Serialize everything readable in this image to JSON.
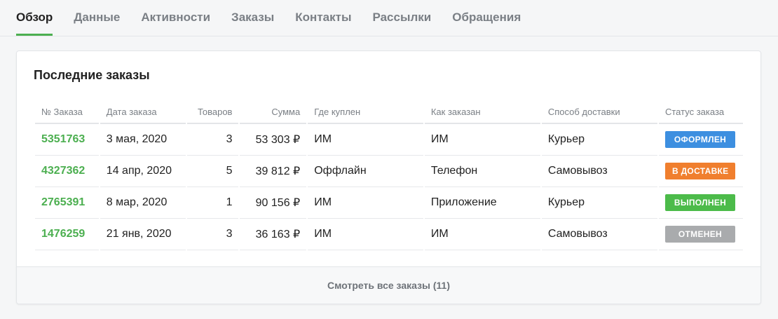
{
  "tabs": [
    {
      "label": "Обзор",
      "active": true
    },
    {
      "label": "Данные",
      "active": false
    },
    {
      "label": "Активности",
      "active": false
    },
    {
      "label": "Заказы",
      "active": false
    },
    {
      "label": "Контакты",
      "active": false
    },
    {
      "label": "Рассылки",
      "active": false
    },
    {
      "label": "Обращения",
      "active": false
    }
  ],
  "orders_card": {
    "title": "Последние заказы",
    "columns": [
      "№ Заказа",
      "Дата заказа",
      "Товаров",
      "Сумма",
      "Где куплен",
      "Как заказан",
      "Способ доставки",
      "Статус заказа"
    ],
    "rows": [
      {
        "number": "5351763",
        "date": "3 мая, 2020",
        "items": "3",
        "sum": "53 303 ₽",
        "where": "ИМ",
        "how": "ИМ",
        "delivery": "Курьер",
        "status": "ОФОРМЛЕН",
        "status_color": "#3d8fe0"
      },
      {
        "number": "4327362",
        "date": "14 апр, 2020",
        "items": "5",
        "sum": "39 812 ₽",
        "where": "Оффлайн",
        "how": "Телефон",
        "delivery": "Самовывоз",
        "status": "В ДОСТАВКЕ",
        "status_color": "#f07f2e"
      },
      {
        "number": "2765391",
        "date": "8 мар, 2020",
        "items": "1",
        "sum": "90 156 ₽",
        "where": "ИМ",
        "how": "Приложение",
        "delivery": "Курьер",
        "status": "ВЫПОЛНЕН",
        "status_color": "#4cbb4a"
      },
      {
        "number": "1476259",
        "date": "21 янв, 2020",
        "items": "3",
        "sum": "36 163 ₽",
        "where": "ИМ",
        "how": "ИМ",
        "delivery": "Самовывоз",
        "status": "ОТМЕНЕН",
        "status_color": "#a9abad"
      }
    ],
    "footer_link": "Смотреть все заказы (11)"
  },
  "colors": {
    "accent": "#4caf50",
    "border": "#e3e5e8",
    "muted_text": "#7a7f85"
  }
}
